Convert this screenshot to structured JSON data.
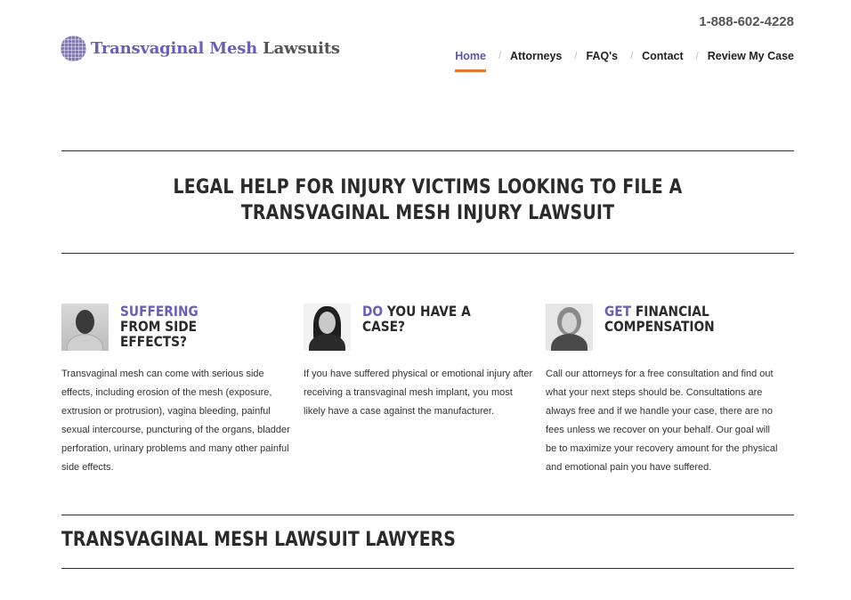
{
  "header": {
    "phone": "1-888-602-4228",
    "logo": {
      "part1": "Transvaginal Mesh",
      "part2": "Lawsuits"
    },
    "nav": [
      {
        "label": "Home",
        "active": true
      },
      {
        "label": "Attorneys"
      },
      {
        "label": "FAQ's"
      },
      {
        "label": "Contact"
      },
      {
        "label": "Review My Case"
      }
    ],
    "nav_separator": "/",
    "accent_color": "#6a5eb8",
    "active_underline_color": "#e8742a"
  },
  "hero": {
    "title": "Legal Help for Injury Victims Looking to File a Transvaginal Mesh Injury Lawsuit"
  },
  "columns": [
    {
      "title_accent": "Suffering",
      "title_rest": " from side effects?",
      "text": "Transvaginal mesh can come with serious side effects, including erosion of the mesh (exposure, extrusion or protrusion), vagina bleeding, painful sexual intercourse, puncturing of the organs, bladder perforation, urinary problems and many other painful side effects."
    },
    {
      "title_accent": "Do",
      "title_rest": " you have a case?",
      "text": "If you have suffered physical or emotional injury after receiving a transvaginal mesh implant, you most likely have a case against the manufacturer."
    },
    {
      "title_accent": "Get",
      "title_rest": " financial compensation",
      "text": "Call our attorneys for a free consultation and find out what your next steps should be. Consultations are always free and if we handle your case, there are no fees unless we recover on your behalf. Our goal will be to maximize your recovery amount for the physical and emotional pain you have suffered."
    }
  ],
  "section": {
    "title": "Transvaginal Mesh Lawsuit Lawyers"
  }
}
